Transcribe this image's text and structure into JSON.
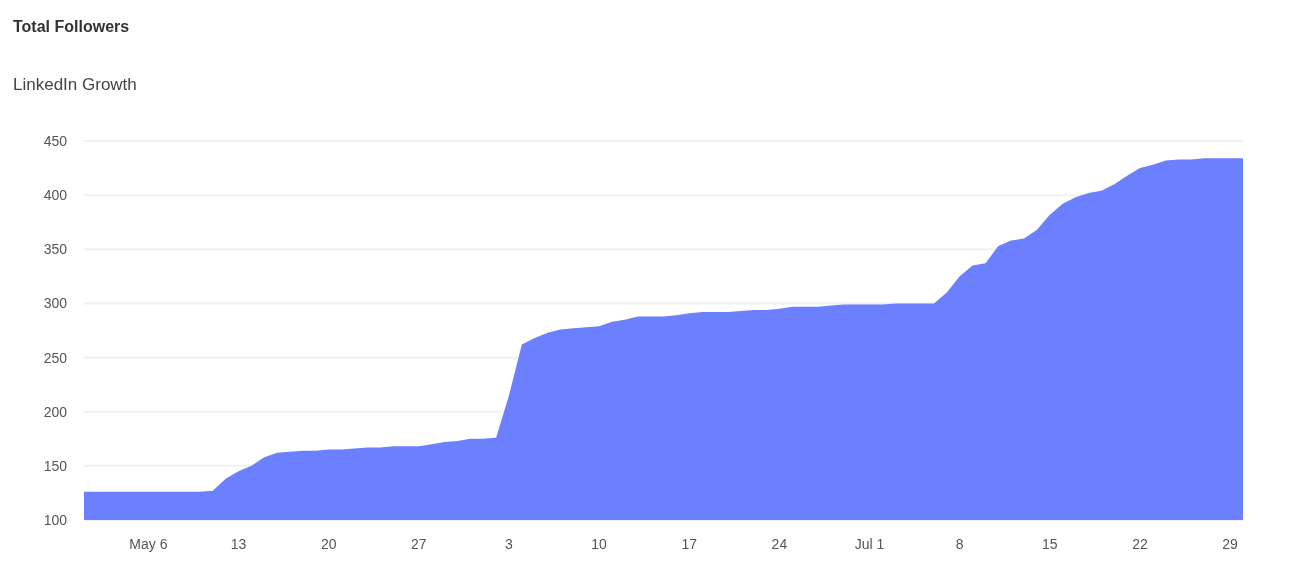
{
  "card": {
    "title": "Total Followers",
    "subtitle": "LinkedIn Growth",
    "chart_data": {
      "type": "area",
      "categories": [
        null,
        null,
        null,
        null,
        null,
        "May 6",
        null,
        null,
        null,
        null,
        null,
        null,
        "13",
        null,
        null,
        null,
        null,
        null,
        null,
        "20",
        null,
        null,
        null,
        null,
        null,
        null,
        "27",
        null,
        null,
        null,
        null,
        null,
        null,
        "3",
        null,
        null,
        null,
        null,
        null,
        null,
        "10",
        null,
        null,
        null,
        null,
        null,
        null,
        "17",
        null,
        null,
        null,
        null,
        null,
        null,
        "24",
        null,
        null,
        null,
        null,
        null,
        null,
        "Jul 1",
        null,
        null,
        null,
        null,
        null,
        null,
        "8",
        null,
        null,
        null,
        null,
        null,
        null,
        "15",
        null,
        null,
        null,
        null,
        null,
        null,
        "22",
        null,
        null,
        null,
        null,
        null,
        null,
        "29",
        null
      ],
      "series": [
        {
          "color": "#6b7fff",
          "values": [
            126,
            126,
            126,
            126,
            126,
            126,
            126,
            126,
            126,
            126,
            127,
            138,
            145,
            150,
            158,
            162,
            163,
            164,
            164,
            165,
            165,
            166,
            167,
            167,
            168,
            168,
            168,
            170,
            172,
            173,
            175,
            175,
            176,
            215,
            262,
            268,
            273,
            276,
            277,
            278,
            279,
            283,
            285,
            288,
            288,
            288,
            289,
            291,
            292,
            292,
            292,
            293,
            294,
            294,
            295,
            297,
            297,
            297,
            298,
            299,
            299,
            299,
            299,
            300,
            300,
            300,
            300,
            310,
            325,
            335,
            337,
            353,
            358,
            360,
            368,
            382,
            392,
            398,
            402,
            404,
            410,
            418,
            425,
            428,
            432,
            433,
            433,
            434,
            434,
            434,
            434
          ]
        }
      ],
      "ylim": [
        100,
        450
      ],
      "grid": true,
      "yticks": [
        100,
        150,
        200,
        250,
        300,
        350,
        400,
        450
      ]
    }
  }
}
